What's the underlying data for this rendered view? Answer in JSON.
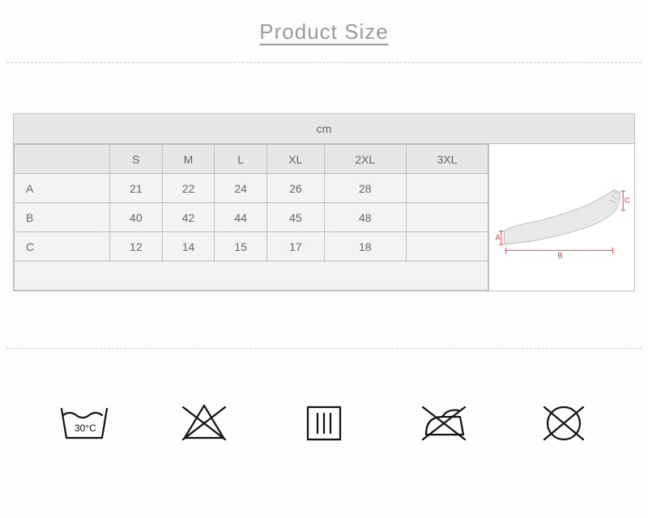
{
  "title": "Product Size",
  "chart_data": {
    "type": "table",
    "title": "Product Size",
    "unit": "cm",
    "columns": [
      "S",
      "M",
      "L",
      "XL",
      "2XL",
      "3XL"
    ],
    "rows": [
      {
        "label": "A",
        "values": [
          "21",
          "22",
          "24",
          "26",
          "28",
          ""
        ]
      },
      {
        "label": "B",
        "values": [
          "40",
          "42",
          "44",
          "45",
          "48",
          ""
        ]
      },
      {
        "label": "C",
        "values": [
          "12",
          "14",
          "15",
          "17",
          "18",
          ""
        ]
      }
    ],
    "diagram_labels": {
      "a": "A",
      "b": "B",
      "c": "C"
    }
  },
  "care_icons": {
    "wash_temp": "30°C",
    "labels": [
      "wash-30",
      "no-bleach",
      "tumble-dry",
      "no-iron",
      "no-dryclean"
    ]
  }
}
